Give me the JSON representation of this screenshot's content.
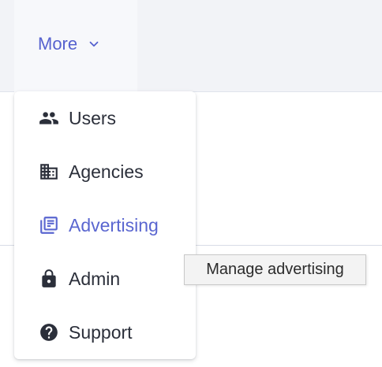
{
  "nav": {
    "more_label": "More"
  },
  "menu": {
    "items": [
      {
        "label": "Users",
        "icon": "users-icon"
      },
      {
        "label": "Agencies",
        "icon": "building-icon"
      },
      {
        "label": "Advertising",
        "icon": "library-books-icon",
        "active": true
      },
      {
        "label": "Admin",
        "icon": "lock-icon"
      },
      {
        "label": "Support",
        "icon": "help-circle-icon"
      }
    ]
  },
  "tooltip": {
    "text": "Manage advertising"
  },
  "colors": {
    "accent": "#5a66d0",
    "text": "#2b2f3a",
    "topbar_bg": "#f2f3f7"
  }
}
